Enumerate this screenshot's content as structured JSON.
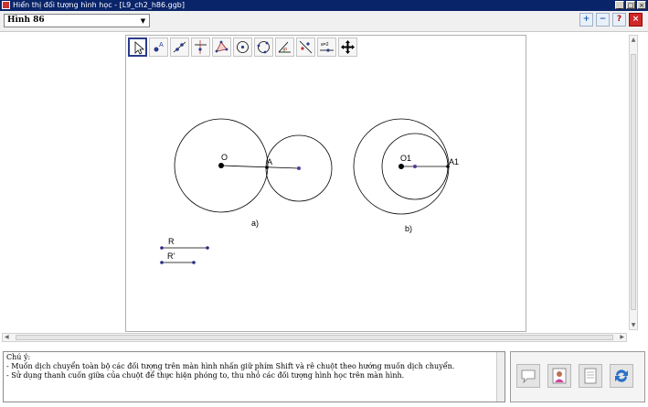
{
  "window": {
    "title": "Hiển thị đối tượng hình học - [L9_ch2_h86.ggb]"
  },
  "figure_select": {
    "value": "Hình 86"
  },
  "toolbar": {
    "tools": [
      {
        "name": "move-tool-icon"
      },
      {
        "name": "point-tool-icon",
        "label": "A"
      },
      {
        "name": "line-tool-icon"
      },
      {
        "name": "perpendicular-tool-icon"
      },
      {
        "name": "polygon-tool-icon"
      },
      {
        "name": "circle-tool-icon"
      },
      {
        "name": "circle-3points-tool-icon"
      },
      {
        "name": "angle-tool-icon",
        "label": "α"
      },
      {
        "name": "reflect-tool-icon"
      },
      {
        "name": "slider-tool-icon",
        "label": "a=2"
      },
      {
        "name": "move-view-tool-icon"
      }
    ]
  },
  "figure": {
    "a": {
      "center_label": "O",
      "tangent_label": "A",
      "caption": "a)"
    },
    "b": {
      "center_label": "O1",
      "tangent_label": "A1",
      "caption": "b)"
    },
    "segment_R_label": "R",
    "segment_R2_label": "R'"
  },
  "notes": {
    "heading": "Chú ý:",
    "line1": "- Muốn dịch chuyển toàn bộ các đối tượng trên màn hình nhấn giữ phím Shift và rê chuột theo hướng muốn dịch chuyển.",
    "line2": "- Sử dụng thanh cuốn giữa của chuột để thực hiện phóng to, thu nhỏ các đối tượng hình học trên màn hình."
  },
  "colors": {
    "titlebar": "#0a246a",
    "point": "#000000",
    "accent_point": "#5a3a9a"
  }
}
